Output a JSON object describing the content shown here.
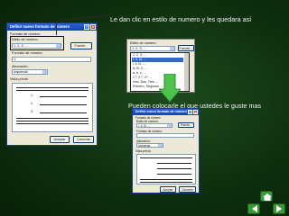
{
  "captions": {
    "top": "Le dan clic en estilo de numero y les quedara así",
    "middle": "Pueden colocarle el que ustedes le guste mas"
  },
  "dialog": {
    "title": "Definir nuevo formato de número",
    "section_format_label": "Formato de número",
    "style_label": "Estilo de número:",
    "style_value": "1, 2, 3, ...",
    "font_button": "Fuente...",
    "format_label": "Formato de número:",
    "format_value": "1.",
    "alignment_label": "Alineación:",
    "alignment_value": "Izquierda",
    "preview_label": "Vista previa",
    "preview_numbers": [
      "1.",
      "2.",
      "3."
    ],
    "ok_button": "Aceptar",
    "cancel_button": "Cancelar",
    "close_glyph": "x",
    "help_glyph": "?"
  },
  "style_list": {
    "items": [
      "1, 2, 3, ...",
      "I, II, III, ...",
      "i, ii, iii, ...",
      "A, B, C, ...",
      "a, b, c, ...",
      "1.º, 2.º, 3.º ...",
      "Uno, Dos, Tres ...",
      "Primero, Segundo ..."
    ],
    "selected_index": 1
  },
  "colors": {
    "background": "#0f300f",
    "title_bar": "#2a63d8",
    "dialog_face": "#ece9d8",
    "selection": "#316ac5",
    "arrow": "#4cc44c"
  },
  "nav": {
    "home_icon": "home-icon",
    "back_icon": "back-arrow-icon",
    "next_icon": "next-arrow-icon"
  }
}
